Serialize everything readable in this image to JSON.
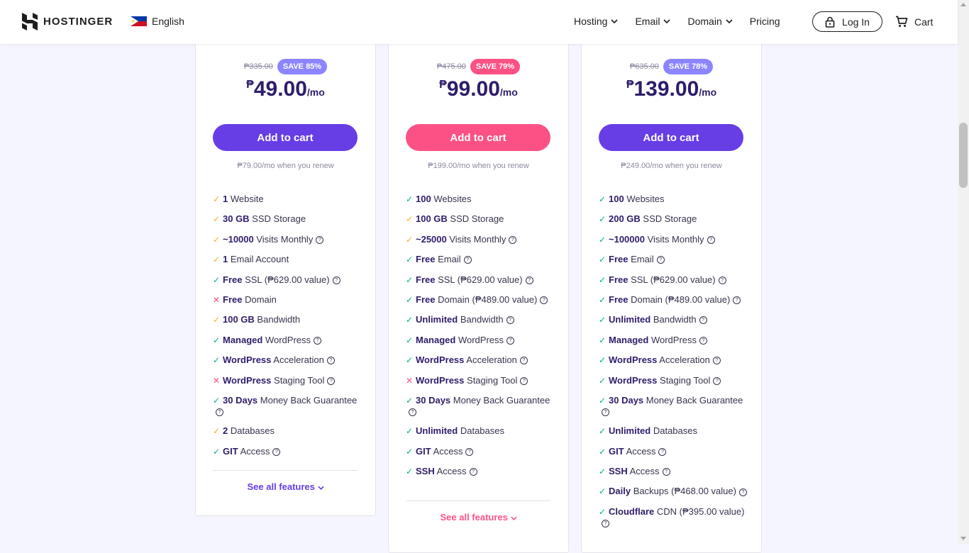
{
  "header": {
    "brand": "HOSTINGER",
    "language": "English",
    "nav": [
      {
        "label": "Hosting",
        "has_dropdown": true
      },
      {
        "label": "Email",
        "has_dropdown": true
      },
      {
        "label": "Domain",
        "has_dropdown": true
      },
      {
        "label": "Pricing",
        "has_dropdown": false
      }
    ],
    "login_label": "Log In",
    "cart_label": "Cart"
  },
  "colors": {
    "purple": "#673de6",
    "pink": "#fc5185",
    "green": "#00b090",
    "yellow": "#ffaa22"
  },
  "plans": [
    {
      "old_price": "₱335.00",
      "save": "SAVE 85%",
      "currency": "₱",
      "price": "49.00",
      "per": "/mo",
      "cta": "Add to cart",
      "renew": "₱79.00/mo when you renew",
      "see_all": "See all features"
    },
    {
      "old_price": "₱475.00",
      "save": "SAVE 79%",
      "currency": "₱",
      "price": "99.00",
      "per": "/mo",
      "cta": "Add to cart",
      "renew": "₱199.00/mo when you renew",
      "see_all": "See all features"
    },
    {
      "old_price": "₱635.00",
      "save": "SAVE 78%",
      "currency": "₱",
      "price": "139.00",
      "per": "/mo",
      "cta": "Add to cart",
      "renew": "₱249.00/mo when you renew",
      "see_all": "See all features"
    }
  ],
  "features": [
    [
      {
        "icon": "check-yellow",
        "bold": "1",
        "text": " Website",
        "help": false
      },
      {
        "icon": "check-yellow",
        "bold": "30 GB",
        "text": " SSD Storage",
        "help": false
      },
      {
        "icon": "check-yellow",
        "bold": "~10000",
        "text": " Visits Monthly",
        "help": true
      },
      {
        "icon": "check-yellow",
        "bold": "1",
        "text": " Email Account",
        "help": false
      },
      {
        "icon": "check-green",
        "bold": "Free",
        "text": " SSL (₱629.00 value)",
        "help": true
      },
      {
        "icon": "cross",
        "bold": "Free",
        "text": " Domain",
        "help": false
      },
      {
        "icon": "check-yellow",
        "bold": "100 GB",
        "text": " Bandwidth",
        "help": false
      },
      {
        "icon": "check-green",
        "bold": "Managed",
        "text": " WordPress",
        "help": true
      },
      {
        "icon": "check-green",
        "bold": "WordPress",
        "text": " Acceleration",
        "help": true
      },
      {
        "icon": "cross",
        "bold": "WordPress",
        "text": " Staging Tool",
        "help": true
      },
      {
        "icon": "check-green",
        "bold": "30 Days",
        "text": " Money Back Guarantee",
        "help": true
      },
      {
        "icon": "check-yellow",
        "bold": "2",
        "text": " Databases",
        "help": false
      },
      {
        "icon": "check-green",
        "bold": "GIT",
        "text": " Access",
        "help": true
      }
    ],
    [
      {
        "icon": "check-green",
        "bold": "100",
        "text": " Websites",
        "help": false
      },
      {
        "icon": "check-yellow",
        "bold": "100 GB",
        "text": " SSD Storage",
        "help": false
      },
      {
        "icon": "check-yellow",
        "bold": "~25000",
        "text": " Visits Monthly",
        "help": true
      },
      {
        "icon": "check-green",
        "bold": "Free",
        "text": " Email",
        "help": true
      },
      {
        "icon": "check-green",
        "bold": "Free",
        "text": " SSL (₱629.00 value)",
        "help": true
      },
      {
        "icon": "check-green",
        "bold": "Free",
        "text": " Domain (₱489.00 value)",
        "help": true
      },
      {
        "icon": "check-green",
        "bold": "Unlimited",
        "text": " Bandwidth",
        "help": true
      },
      {
        "icon": "check-green",
        "bold": "Managed",
        "text": " WordPress",
        "help": true
      },
      {
        "icon": "check-green",
        "bold": "WordPress",
        "text": " Acceleration",
        "help": true
      },
      {
        "icon": "cross",
        "bold": "WordPress",
        "text": " Staging Tool",
        "help": true
      },
      {
        "icon": "check-green",
        "bold": "30 Days",
        "text": " Money Back Guarantee",
        "help": true
      },
      {
        "icon": "check-green",
        "bold": "Unlimited",
        "text": " Databases",
        "help": false
      },
      {
        "icon": "check-green",
        "bold": "GIT",
        "text": " Access",
        "help": true
      },
      {
        "icon": "check-green",
        "bold": "SSH",
        "text": " Access",
        "help": true
      }
    ],
    [
      {
        "icon": "check-green",
        "bold": "100",
        "text": " Websites",
        "help": false
      },
      {
        "icon": "check-green",
        "bold": "200 GB",
        "text": " SSD Storage",
        "help": false
      },
      {
        "icon": "check-green",
        "bold": "~100000",
        "text": " Visits Monthly",
        "help": true
      },
      {
        "icon": "check-green",
        "bold": "Free",
        "text": " Email",
        "help": true
      },
      {
        "icon": "check-green",
        "bold": "Free",
        "text": " SSL (₱629.00 value)",
        "help": true
      },
      {
        "icon": "check-green",
        "bold": "Free",
        "text": " Domain (₱489.00 value)",
        "help": true
      },
      {
        "icon": "check-green",
        "bold": "Unlimited",
        "text": " Bandwidth",
        "help": true
      },
      {
        "icon": "check-green",
        "bold": "Managed",
        "text": " WordPress",
        "help": true
      },
      {
        "icon": "check-green",
        "bold": "WordPress",
        "text": " Acceleration",
        "help": true
      },
      {
        "icon": "check-green",
        "bold": "WordPress",
        "text": " Staging Tool",
        "help": true
      },
      {
        "icon": "check-green",
        "bold": "30 Days",
        "text": " Money Back Guarantee",
        "help": true
      },
      {
        "icon": "check-green",
        "bold": "Unlimited",
        "text": " Databases",
        "help": false
      },
      {
        "icon": "check-green",
        "bold": "GIT",
        "text": " Access",
        "help": true
      },
      {
        "icon": "check-green",
        "bold": "SSH",
        "text": " Access",
        "help": true
      },
      {
        "icon": "check-green",
        "bold": "Daily",
        "text": " Backups (₱468.00 value)",
        "help": true
      },
      {
        "icon": "check-green",
        "bold": "Cloudflare",
        "text": " CDN (₱395.00 value)",
        "help": true
      }
    ]
  ]
}
